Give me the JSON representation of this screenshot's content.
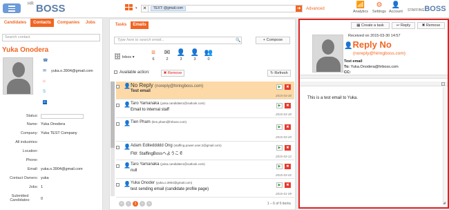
{
  "header": {
    "logo_prefix": "HR",
    "logo_main": "BOSS",
    "search_tag": "TEXT: @gmail.com",
    "advanced_label": "Advanced",
    "analytics_label": "Analytics",
    "settings_label": "Settings",
    "account_label": "Account",
    "brand_prefix": "STAFFING",
    "brand_main": "BOSS"
  },
  "left": {
    "tabs": [
      "Candidates",
      "Contacts",
      "Companies",
      "Jobs"
    ],
    "search_placeholder": "Search contact",
    "contact_name": "Yuka Onodera",
    "contact_email": "yuka.o.3904@gmail.com",
    "fields": [
      {
        "label": "Status:",
        "value": ""
      },
      {
        "label": "Name:",
        "value": "Yuka Onodera"
      },
      {
        "label": "Company:",
        "value": "Yuka TEST Company"
      },
      {
        "label": "All industries:",
        "value": ""
      },
      {
        "label": "Location:",
        "value": ""
      },
      {
        "label": "Phone:",
        "value": ""
      },
      {
        "label": "Email:",
        "value": "yuka.o.3904@gmail.com"
      },
      {
        "label": "Contact Owners:",
        "value": "yuka"
      },
      {
        "label": "Jobs:",
        "value": "1"
      },
      {
        "label": "Submitted Candidates:",
        "value": "0"
      }
    ]
  },
  "mid": {
    "tabs": [
      "Tasks",
      "Emails"
    ],
    "search_placeholder": "Type here to search email...",
    "compose_label": "+ Compose",
    "inbox_label": "Inbox",
    "stats": [
      {
        "icon": "≡",
        "count": "6",
        "color": "#f26522"
      },
      {
        "icon": "✉",
        "count": "2",
        "color": "#333333"
      },
      {
        "icon": "👤",
        "count": "3",
        "color": "#3b6fb0"
      },
      {
        "icon": "👤",
        "count": "3",
        "color": "#f26522"
      },
      {
        "icon": "👥",
        "count": "0",
        "color": "#f26522"
      }
    ],
    "available_action_label": "Available action:",
    "remove_label": "✖ Remove",
    "refresh_label": "↻ Refresh",
    "emails": [
      {
        "from": "No Reply",
        "addr": "(noreply@hiringboss.com)",
        "subject": "Test email",
        "date": "2015-03-30"
      },
      {
        "from": "Taro Yamanaka",
        "addr": "(yuka.candidate1@outlook.com)",
        "subject": "Email to internal staff",
        "date": "2015-03-30"
      },
      {
        "from": "Tien Pham",
        "addr": "(tien.pham@hrboss.com)",
        "subject": "",
        "date": "2015-03-20"
      },
      {
        "from": "Adam Editeddddd Ong",
        "addr": "(staffing.power.user.2@gmail.com)",
        "subject": "FW: StaffingBossへようこそ",
        "date": "2015-03-12"
      },
      {
        "from": "Taro Yamanaka",
        "addr": "(yuka.candidate1@outlook.com)",
        "subject": "null",
        "date": "2015-03-02"
      },
      {
        "from": "Yuka Onoder",
        "addr": "(yuka.o.3904@gmail.com)",
        "subject": "test sending email (candidate profile page)",
        "date": "2015-01-09"
      }
    ],
    "pages": [
      "«",
      "‹",
      "1",
      "›",
      "»"
    ],
    "page_info": "1 – 6 of 6 items"
  },
  "detail": {
    "create_task": "Create a task",
    "reply": "Reply",
    "remove": "✖ Remove",
    "received": "Received on 2015-03-30 14:57",
    "subject": "Reply No",
    "sender": "(noreply@hiringboss.com)",
    "title_line": "Test email",
    "to_label": "To:",
    "to_value": "Yuka.Onodera@hrboss.com",
    "cc_label": "CC:",
    "body": "This is a test email to Yuka."
  }
}
